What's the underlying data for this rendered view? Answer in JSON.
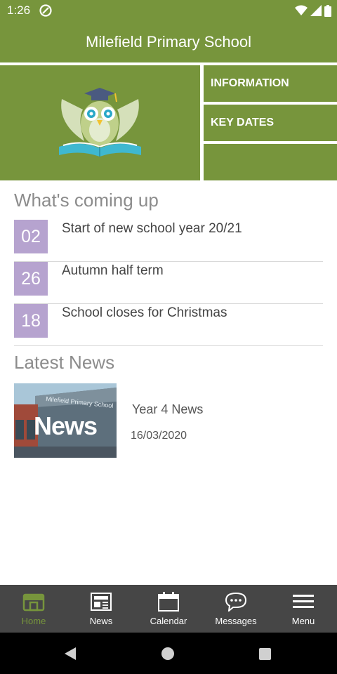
{
  "status_bar": {
    "time": "1:26"
  },
  "app_bar": {
    "title": "Milefield Primary School"
  },
  "hero": {
    "tiles": [
      {
        "label": "INFORMATION"
      },
      {
        "label": "KEY DATES"
      },
      {
        "label": ""
      }
    ]
  },
  "upcoming": {
    "heading": "What's coming up",
    "events": [
      {
        "day": "02",
        "title": "Start of new school year 20/21"
      },
      {
        "day": "26",
        "title": "Autumn half term"
      },
      {
        "day": "18",
        "title": "School closes for Christmas"
      }
    ]
  },
  "latest_news": {
    "heading": "Latest News",
    "items": [
      {
        "thumb_word": "News",
        "thumb_sign": "Milefield Primary School",
        "title": "Year 4 News",
        "date": "16/03/2020"
      }
    ]
  },
  "bottom_nav": {
    "items": [
      {
        "label": "Home",
        "icon": "home-icon",
        "active": true
      },
      {
        "label": "News",
        "icon": "news-icon",
        "active": false
      },
      {
        "label": "Calendar",
        "icon": "calendar-icon",
        "active": false
      },
      {
        "label": "Messages",
        "icon": "messages-icon",
        "active": false
      },
      {
        "label": "Menu",
        "icon": "menu-icon",
        "active": false
      }
    ]
  },
  "colors": {
    "brand_green": "#77953c",
    "date_badge": "#b6a3cf",
    "nav_bg": "#464646"
  }
}
